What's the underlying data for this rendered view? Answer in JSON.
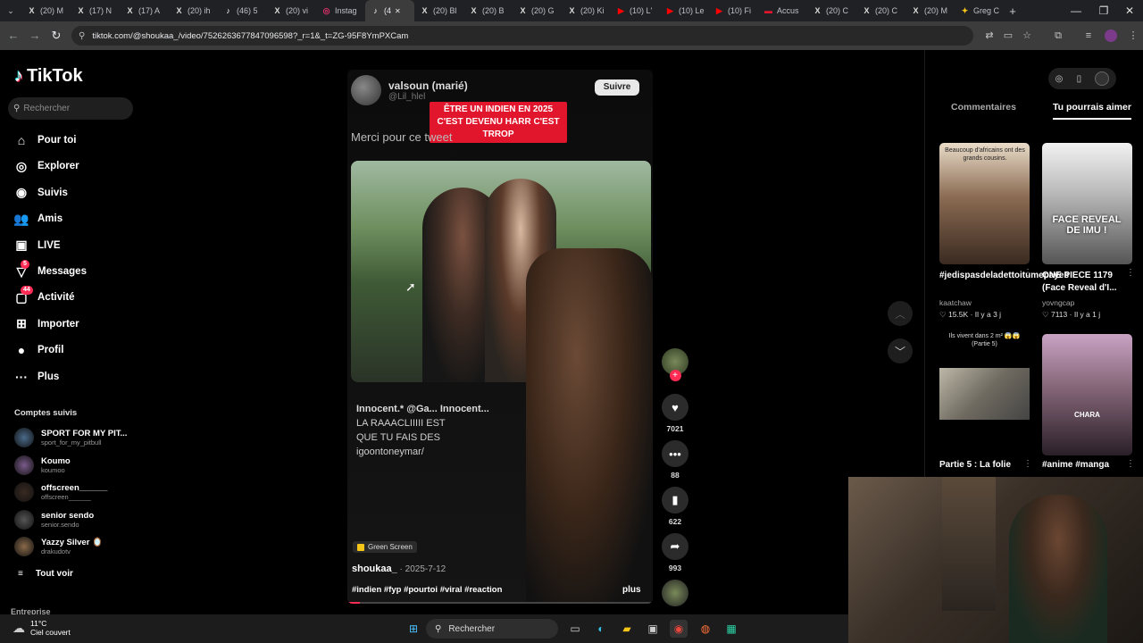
{
  "browser": {
    "tabs": [
      {
        "icon": "X",
        "label": "(20) M"
      },
      {
        "icon": "X",
        "label": "(17) N"
      },
      {
        "icon": "X",
        "label": "(17) A"
      },
      {
        "icon": "X",
        "label": "(20) ih"
      },
      {
        "icon": "♪",
        "label": "(46) 5"
      },
      {
        "icon": "X",
        "label": "(20) vi"
      },
      {
        "icon": "◎",
        "label": "Instag"
      },
      {
        "icon": "♪",
        "label": "(4"
      },
      {
        "icon": "X",
        "label": "(20) Bl"
      },
      {
        "icon": "X",
        "label": "(20) B"
      },
      {
        "icon": "X",
        "label": "(20) G"
      },
      {
        "icon": "X",
        "label": "(20) Ki"
      },
      {
        "icon": "▶",
        "label": "(10) L'"
      },
      {
        "icon": "▶",
        "label": "(10) Le"
      },
      {
        "icon": "▶",
        "label": "(10) Fi"
      },
      {
        "icon": "▬",
        "label": "Accus"
      },
      {
        "icon": "X",
        "label": "(20) C"
      },
      {
        "icon": "X",
        "label": "(20) C"
      },
      {
        "icon": "X",
        "label": "(20) M"
      },
      {
        "icon": "✦",
        "label": "Greg C"
      }
    ],
    "new_tab": "+",
    "url": "tiktok.com/@shoukaa_/video/7526263677847096598?_r=1&_t=ZG-95F8YmPXCam"
  },
  "sidebar": {
    "logo": "TikTok",
    "search_placeholder": "Rechercher",
    "nav": [
      {
        "icon": "⌂",
        "label": "Pour toi",
        "badge": ""
      },
      {
        "icon": "◎",
        "label": "Explorer",
        "badge": ""
      },
      {
        "icon": "◉",
        "label": "Suivis",
        "badge": ""
      },
      {
        "icon": "👥",
        "label": "Amis",
        "badge": ""
      },
      {
        "icon": "▣",
        "label": "LIVE",
        "badge": ""
      },
      {
        "icon": "▽",
        "label": "Messages",
        "badge": "5"
      },
      {
        "icon": "▢",
        "label": "Activité",
        "badge": "44"
      },
      {
        "icon": "⊞",
        "label": "Importer",
        "badge": ""
      },
      {
        "icon": "●",
        "label": "Profil",
        "badge": ""
      },
      {
        "icon": "···",
        "label": "Plus",
        "badge": ""
      }
    ],
    "following_heading": "Comptes suivis",
    "following": [
      {
        "name": "SPORT FOR MY PIT...",
        "user": "sport_for_my_pitbull"
      },
      {
        "name": "Koumo",
        "user": "koumoo"
      },
      {
        "name": "offscreen______",
        "user": "offscreen______"
      },
      {
        "name": "senior sendo",
        "user": "senior.sendo"
      },
      {
        "name": "Yazzy Silver 🪞",
        "user": "drakudotv"
      }
    ],
    "see_all": "Tout voir",
    "see_all_icon": "≡",
    "business": "Entreprise"
  },
  "video": {
    "author_name": "valsoun (marié)",
    "author_handle": "@Lil_hlel",
    "follow_label": "Suivre",
    "overlay_text": "ÊTRE UN INDIEN EN 2025 C'EST DEVENU HARR C'EST TRROP",
    "tweet_text": "Merci pour ce tweet",
    "comment_user": "Innocent.*  @Ga... Innocent...",
    "comment_lines": [
      "LA RAAACLIIIII EST",
      "QUE TU FAIS DES",
      "igoontoneymar/"
    ],
    "effect_label": "Green Screen",
    "creator": "shoukaa_",
    "date": " · 2025-7-12",
    "hashtags": "#indien #fyp #pourtoi #viral #reaction",
    "more_label": "plus",
    "progress": 0.04
  },
  "actions": {
    "likes": "7021",
    "comments": "88",
    "saves": "622",
    "shares": "993"
  },
  "right_panel": {
    "tabs": [
      "Commentaires",
      "Tu pourrais aimer"
    ],
    "cards": [
      {
        "title": "#jedispasdeladettoitumepayes",
        "author": "kaatchaw",
        "likes": "♡ 15.5K",
        "ago": "· Il y a 3 j",
        "caption": "Beaucoup d'africains ont des grands cousins."
      },
      {
        "title": "ONE PIECE 1179 (Face Reveal d'I...",
        "author": "yovngcap",
        "likes": "♡ 7113",
        "ago": "· Il y a 1 j",
        "caption": "FACE REVEAL DE IMU !"
      },
      {
        "title": "Partie 5 : La folie",
        "author": "",
        "likes": "",
        "ago": "",
        "caption": "Ils vivent dans 2 m² 😱😱 (Partie 5)"
      },
      {
        "title": "#anime #manga",
        "author": "",
        "likes": "",
        "ago": "",
        "caption": "CHARA"
      }
    ]
  },
  "taskbar": {
    "temp": "11°C",
    "weather": "Ciel couvert",
    "search": "Rechercher"
  },
  "colors": {
    "accent": "#fe2c55",
    "overlay_red": "#e1162c"
  }
}
